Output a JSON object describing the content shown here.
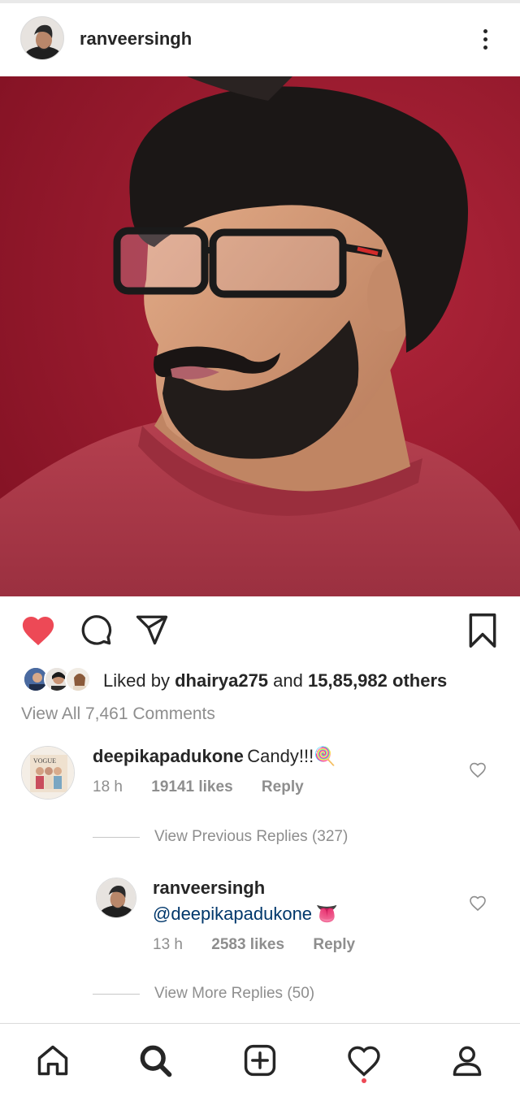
{
  "header": {
    "username": "ranveersingh"
  },
  "post": {
    "liked_prefix": "Liked by",
    "liked_user": "dhairya275",
    "liked_conj": "and",
    "liked_others": "15,85,982 others",
    "view_all_comments": "View All 7,461 Comments",
    "like_color": "#ed4956"
  },
  "comments": [
    {
      "username": "deepikapadukone",
      "text": "Candy!!!",
      "emoji": "🍭",
      "time": "18 h",
      "likes": "19141 likes",
      "reply": "Reply"
    }
  ],
  "view_previous_replies": "View Previous Replies (327)",
  "reply": {
    "username": "ranveersingh",
    "mention": "@deepikapadukone",
    "emoji": "👅",
    "time": "13 h",
    "likes": "2583 likes",
    "reply": "Reply"
  },
  "view_more_replies": "View More Replies (50)",
  "icons": {
    "more": "more-vertical-icon",
    "like": "heart-filled-icon",
    "comment": "comment-icon",
    "share": "share-icon",
    "save": "bookmark-icon",
    "nav": [
      "home-icon",
      "search-icon",
      "add-post-icon",
      "activity-heart-icon",
      "profile-icon"
    ]
  }
}
